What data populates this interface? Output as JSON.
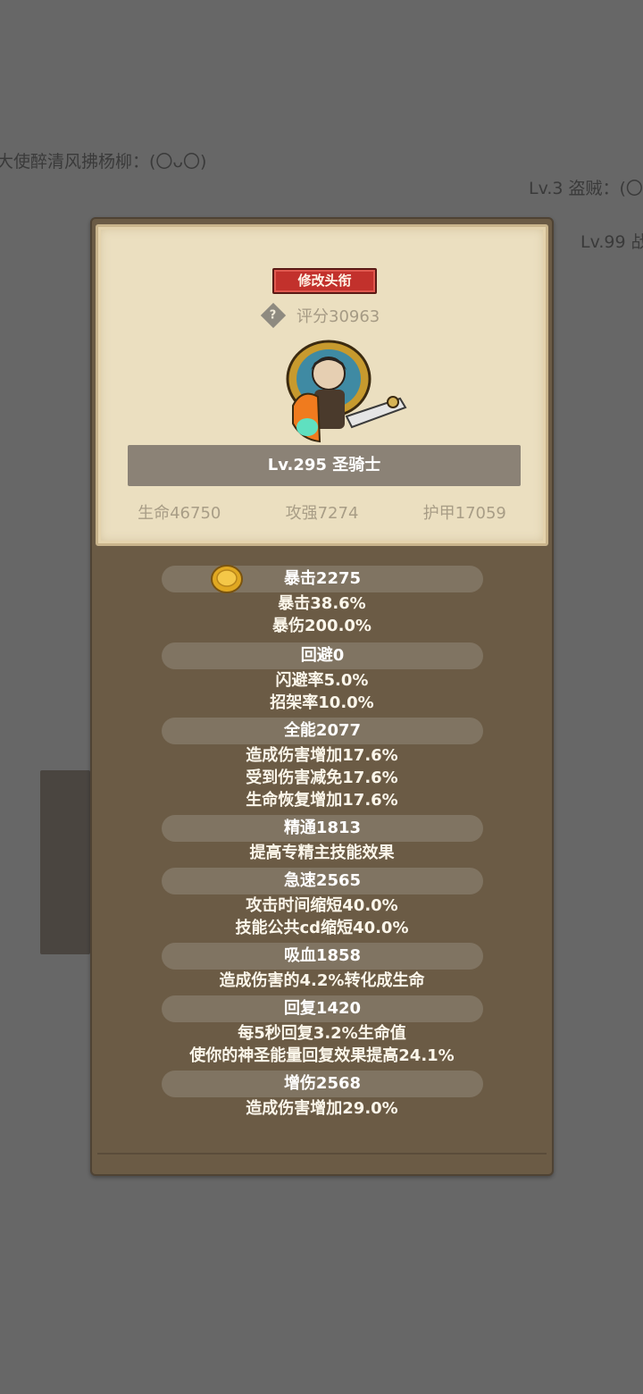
{
  "background": {
    "chat_lines": [
      "大使醉清风拂杨柳：(〇ᴗ〇)",
      "Lv.3 盗贼：(〇",
      "Lv.99 战"
    ]
  },
  "profile": {
    "rename_button": "修改头衔",
    "help_icon": "?",
    "score": "评分30963",
    "title": "Lv.295 圣骑士",
    "stats": [
      "生命46750",
      "攻强7274",
      "护甲17059"
    ]
  },
  "attributes": [
    {
      "header": "暴击2275",
      "lines": [
        "暴击38.6%",
        "暴伤200.0%"
      ]
    },
    {
      "header": "回避0",
      "lines": [
        "闪避率5.0%",
        "招架率10.0%"
      ]
    },
    {
      "header": "全能2077",
      "lines": [
        "造成伤害增加17.6%",
        "受到伤害减免17.6%",
        "生命恢复增加17.6%"
      ]
    },
    {
      "header": "精通1813",
      "lines": [
        "提高专精主技能效果"
      ]
    },
    {
      "header": "急速2565",
      "lines": [
        "攻击时间缩短40.0%",
        "技能公共cd缩短40.0%"
      ]
    },
    {
      "header": "吸血1858",
      "lines": [
        "造成伤害的4.2%转化成生命"
      ]
    },
    {
      "header": "回复1420",
      "lines": [
        "每5秒回复3.2%生命值",
        "使你的神圣能量回复效果提高24.1%"
      ]
    },
    {
      "header": "增伤2568",
      "lines": [
        "造成伤害增加29.0%"
      ]
    }
  ],
  "colors": {
    "page_bg": "#676767",
    "panel_bg": "#6b5b45",
    "paper_bg": "#ebdfc0",
    "button_red": "#c2312c",
    "header_pill": "#807462"
  }
}
